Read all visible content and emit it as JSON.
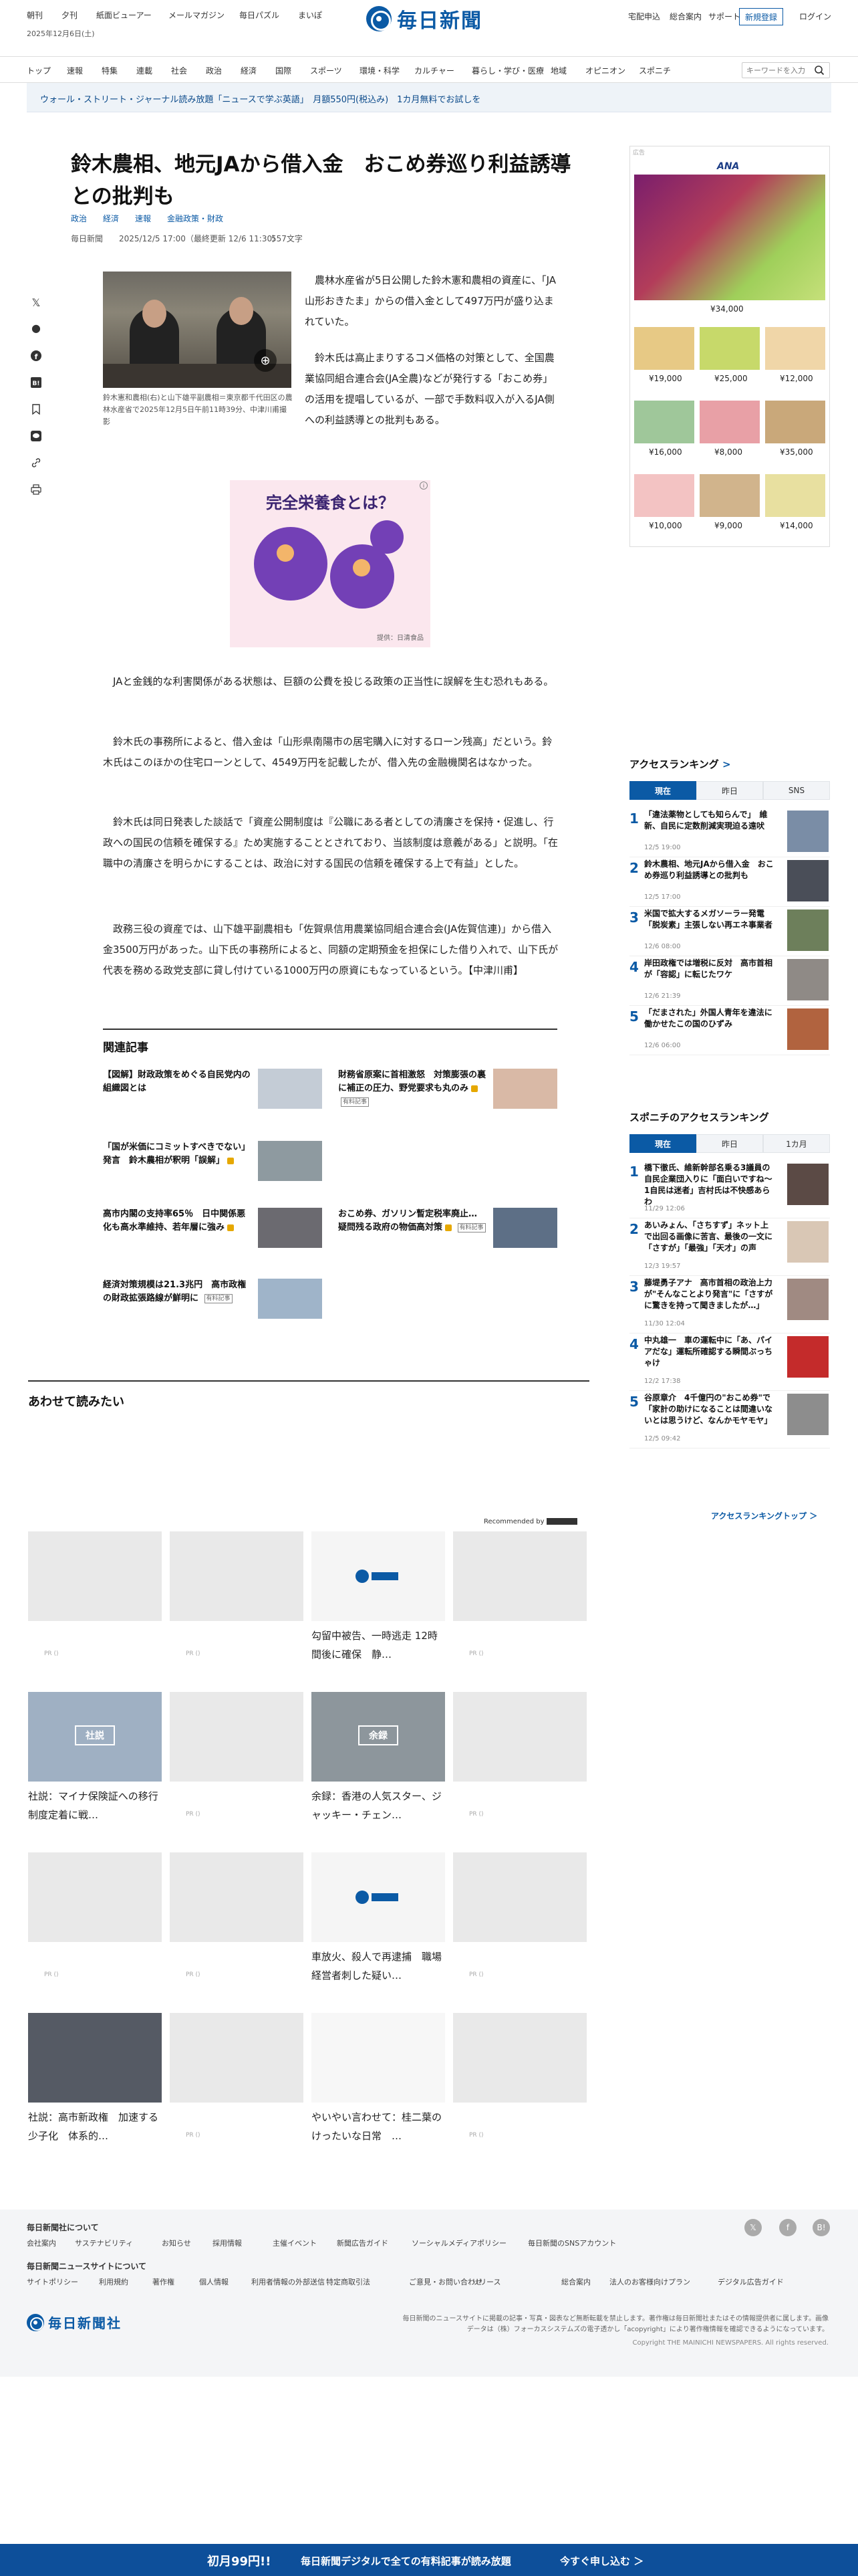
{
  "header": {
    "top_links": [
      "朝刊",
      "夕刊",
      "紙面ビューアー",
      "メールマガジン",
      "毎日パズル",
      "まいぽ"
    ],
    "logo_text": "毎日新聞",
    "right_links": [
      "宅配申込",
      "総合案内",
      "サポート"
    ],
    "register": "新規登録",
    "login": "ログイン",
    "date": "2025年12月6日(土)"
  },
  "nav": {
    "items": [
      "トップ",
      "速報",
      "特集",
      "連載",
      "社会",
      "政治",
      "経済",
      "国際",
      "スポーツ",
      "環境・科学",
      "カルチャー",
      "暮らし・学び・医療",
      "地域",
      "オピニオン",
      "スポニチ"
    ],
    "search_placeholder": "キーワードを入力"
  },
  "promo": "ウォール・ストリート・ジャーナル読み放題「ニュースで学ぶ英語」　月額550円(税込み)　1カ月無料でお試しを",
  "article": {
    "headline": "鈴木農相、地元JAから借入金　おこめ券巡り利益誘導との批判も",
    "tags": [
      "政治",
      "経済",
      "速報",
      "金融政策・財政"
    ],
    "source": "毎日新聞",
    "published": "2025/12/5 17:00（最終更新 12/6 11:30）",
    "length": "557文字",
    "caption": "鈴木憲和農相(右)と山下雄平副農相＝東京都千代田区の農林水産省で2025年12月5日午前11時39分、中津川甫撮影",
    "paragraphs": [
      "農林水産省が5日公開した鈴木憲和農相の資産に、「JA山形おきたま」からの借入金として497万円が盛り込まれていた。",
      "鈴木氏は高止まりするコメ価格の対策として、全国農業協同組合連合会(JA全農)などが発行する「おこめ券」の活用を提唱しているが、一部で手数料収入が入るJA側への利益誘導との批判もある。",
      "JAと金銭的な利害関係がある状態は、巨額の公費を投じる政策の正当性に誤解を生む恐れもある。",
      "鈴木氏の事務所によると、借入金は「山形県南陽市の居宅購入に対するローン残高」だという。鈴木氏はこのほかの住宅ローンとして、4549万円を記載したが、借入先の金融機関名はなかった。",
      "鈴木氏は同日発表した談話で「資産公開制度は『公職にある者としての清廉さを保持・促進し、行政への国民の信頼を確保する』ため実施することとされており、当該制度は意義がある」と説明。「在職中の清廉さを明らかにすることは、政治に対する国民の信頼を確保する上で有益」とした。",
      "政務三役の資産では、山下雄平副農相も「佐賀県信用農業協同組合連合会(JA佐賀信連)」から借入金3500万円があった。山下氏の事務所によると、同額の定期預金を担保にした借り入れで、山下氏が代表を務める政党支部に貸し付けている1000万円の原資にもなっているという。【中津川甫】"
    ]
  },
  "inline_ad": {
    "title": "完全栄養食とは？",
    "credit": "提供：日清食品"
  },
  "related": {
    "title": "関連記事",
    "items": [
      {
        "text": "【図解】財政政策をめぐる自民党内の組織図とは",
        "badge": ""
      },
      {
        "text": "財務省原案に首相激怒　対策膨張の裏に補正の圧力、野党要求も丸のみ",
        "badge": "有料記事"
      },
      {
        "text": "「国が米価にコミットすべきでない」発言　鈴木農相が釈明「誤解」",
        "badge": ""
      },
      {
        "text": "高市内閣の支持率65％　日中関係悪化も高水準維持、若年層に強み",
        "badge": ""
      },
      {
        "text": "おこめ券、ガソリン暫定税率廃止…　疑問残る政府の物価高対策",
        "badge": "有料記事"
      },
      {
        "text": "経済対策規模は21.3兆円　高市政権の財政拡張路線が鮮明に",
        "badge": "有料記事"
      }
    ]
  },
  "also_read": {
    "title": "あわせて読みたい",
    "recommended": "Recommended by",
    "cards": [
      {
        "text": "",
        "pr": "PR ()"
      },
      {
        "text": "",
        "pr": "PR ()"
      },
      {
        "text": "勾留中被告、一時逃走 12時間後に確保　静…",
        "pr": ""
      },
      {
        "text": "",
        "pr": "PR ()"
      },
      {
        "text": "社説：マイナ保険証への移行　制度定着に戦…",
        "pr": ""
      },
      {
        "text": "",
        "pr": "PR ()"
      },
      {
        "text": "余録：香港の人気スター、ジャッキー・チェン…",
        "pr": ""
      },
      {
        "text": "",
        "pr": "PR ()"
      },
      {
        "text": "",
        "pr": "PR ()"
      },
      {
        "text": "",
        "pr": "PR ()"
      },
      {
        "text": "車放火、殺人で再逮捕　職場経営者刺した疑い…",
        "pr": ""
      },
      {
        "text": "",
        "pr": "PR ()"
      },
      {
        "text": "社説：高市新政権　加速する少子化　体系的…",
        "pr": ""
      },
      {
        "text": "",
        "pr": "PR ()"
      },
      {
        "text": "やいやい言わせて：桂二葉のけったいな日常　…",
        "pr": ""
      },
      {
        "text": "",
        "pr": "PR ()"
      }
    ],
    "img_labels": [
      "社説",
      "余録"
    ]
  },
  "sidebar_ad": {
    "brand": "ANA",
    "price_main": "¥34,000",
    "prices": [
      "¥19,000",
      "¥25,000",
      "¥12,000",
      "¥16,000",
      "¥8,000",
      "¥35,000",
      "¥10,000",
      "¥9,000",
      "¥14,000"
    ],
    "label": "広告"
  },
  "access_ranking": {
    "title": "アクセスランキング",
    "tabs": [
      "現在",
      "昨日",
      "SNS"
    ],
    "items": [
      {
        "n": "1",
        "title": "「違法薬物としても知らんで」　維新、自民に定数削減実現迫る遠吠",
        "time": "12/5 19:00"
      },
      {
        "n": "2",
        "title": "鈴木農相、地元JAから借入金　おこめ券巡り利益誘導との批判も",
        "time": "12/5 17:00"
      },
      {
        "n": "3",
        "title": "米国で拡大するメガソーラー発電　「脱炭素」主張しない再エネ事業者",
        "time": "12/6 08:00"
      },
      {
        "n": "4",
        "title": "岸田政権では増税に反対　高市首相が「容認」に転じたワケ",
        "time": "12/6 21:39"
      },
      {
        "n": "5",
        "title": "「だまされた」外国人青年を違法に働かせたこの国のひずみ",
        "time": "12/6 06:00"
      }
    ]
  },
  "sponichi_ranking": {
    "title": "スポニチのアクセスランキング",
    "tabs": [
      "現在",
      "昨日",
      "1カ月"
    ],
    "items": [
      {
        "n": "1",
        "title": "橋下徹氏、維新幹部名乗る3議員の自民企業団入りに「面白いですね〜1自民は迷者」吉村氏は不快感あらわ",
        "time": "11/29 12:06"
      },
      {
        "n": "2",
        "title": "あいみょん、「さちすず」ネット上で出回る画像に苦言、最後の一文に「さすが」「最強」「天才」の声",
        "time": "12/3 19:57"
      },
      {
        "n": "3",
        "title": "藤堤勇子アナ　高市首相の政治上力が\"そんなことより発言\"に「さすがに驚きを持って聞きましたが…」",
        "time": "11/30 12:04"
      },
      {
        "n": "4",
        "title": "中丸雄一　車の運転中に「あ、パイアだな」運転所確認する瞬間ぶっちゃけ",
        "time": "12/2 17:38"
      },
      {
        "n": "5",
        "title": "谷原章介　4千億円の\"おこめ券\"で「家計の助けになることは間違いないとは思うけど、なんかモヤモヤ」",
        "time": "12/5 09:42"
      }
    ],
    "more": "アクセスランキングトップ ＞"
  },
  "footer": {
    "about_title": "毎日新聞社について",
    "about_links": [
      "会社案内",
      "サステナビリティ",
      "お知らせ",
      "採用情報",
      "主催イベント",
      "新聞広告ガイド",
      "ソーシャルメディアポリシー",
      "毎日新聞のSNSアカウント"
    ],
    "site_title": "毎日新聞ニュースサイトについて",
    "site_links": [
      "サイトポリシー",
      "利用規約",
      "著作権",
      "個人情報",
      "利用者情報の外部送信",
      "特定商取引法",
      "ご意見・お問い合わせ",
      "リリース",
      "総合案内",
      "法人のお客様向けプラン",
      "デジタル広告ガイド"
    ],
    "logo": "毎日新聞社",
    "notice": "毎日新聞のニュースサイトに掲載の記事・写真・図表など無断転載を禁止します。著作権は毎日新聞社またはその情報提供者に属します。画像データは（株）フォーカスシステムズの電子透かし「acopyright」により著作権情報を確認できるようになっています。",
    "copyright": "Copyright THE MAINICHI NEWSPAPERS. All rights reserved."
  },
  "bottom_banner": {
    "lead": "初月99円!!",
    "text": "毎日新聞デジタルで全ての有料記事が読み放題",
    "cta": "今すぐ申し込む ＞"
  }
}
